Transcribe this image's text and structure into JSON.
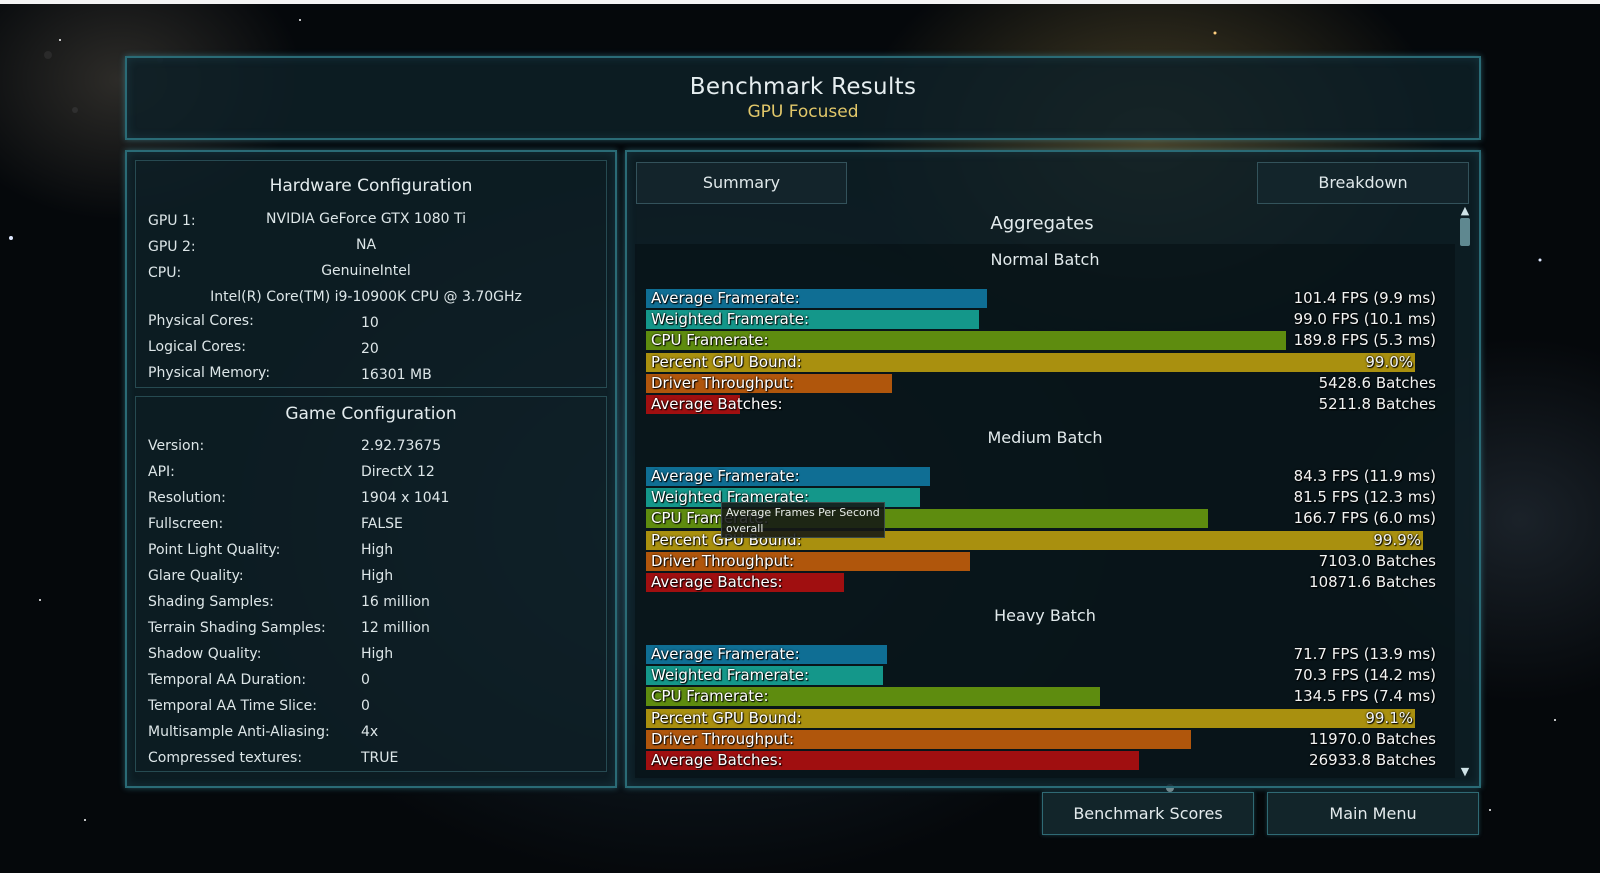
{
  "header": {
    "title": "Benchmark Results",
    "subtitle": "GPU Focused"
  },
  "hardware": {
    "title": "Hardware Configuration",
    "gpu1_label": "GPU 1:",
    "gpu1_value": "NVIDIA GeForce GTX 1080 Ti",
    "gpu2_label": "GPU 2:",
    "gpu2_value": "NA",
    "cpu_label": "CPU:",
    "cpu_vendor": "GenuineIntel",
    "cpu_model": "Intel(R) Core(TM) i9-10900K CPU @ 3.70GHz",
    "rows": [
      {
        "label": "Physical Cores:",
        "value": "10"
      },
      {
        "label": "Logical Cores:",
        "value": "20"
      },
      {
        "label": "Physical Memory:",
        "value": "16301  MB"
      }
    ]
  },
  "game": {
    "title": "Game Configuration",
    "rows": [
      {
        "label": "Version:",
        "value": "2.92.73675"
      },
      {
        "label": "API:",
        "value": "DirectX 12"
      },
      {
        "label": "Resolution:",
        "value": "1904 x 1041"
      },
      {
        "label": "Fullscreen:",
        "value": "FALSE"
      },
      {
        "label": "Point Light Quality:",
        "value": "High"
      },
      {
        "label": "Glare Quality:",
        "value": "High"
      },
      {
        "label": "Shading Samples:",
        "value": "16 million"
      },
      {
        "label": "Terrain Shading Samples:",
        "value": "12 million"
      },
      {
        "label": "Shadow Quality:",
        "value": "High"
      },
      {
        "label": "Temporal AA Duration:",
        "value": "0"
      },
      {
        "label": "Temporal AA Time Slice:",
        "value": "0"
      },
      {
        "label": "Multisample Anti-Aliasing:",
        "value": "4x"
      },
      {
        "label": "Compressed textures:",
        "value": "TRUE"
      }
    ]
  },
  "tabs": {
    "summary": "Summary",
    "breakdown": "Breakdown"
  },
  "aggregates_title": "Aggregates",
  "metric_colors": {
    "avg_framerate": "#0f6e94",
    "weighted_framerate": "#14978a",
    "cpu_framerate": "#5e8c0f",
    "gpu_bound": "#a9900f",
    "driver_throughput": "#b0560c",
    "avg_batches": "#a00f10"
  },
  "batches": [
    {
      "title": "Normal Batch",
      "metrics": [
        {
          "key": "avg_framerate",
          "label": "Average Framerate:",
          "value": "101.4 FPS (9.9 ms)",
          "fill": 0.432
        },
        {
          "key": "weighted_framerate",
          "label": "Weighted Framerate:",
          "value": "99.0 FPS (10.1 ms)",
          "fill": 0.422
        },
        {
          "key": "cpu_framerate",
          "label": "CPU Framerate:",
          "value": "189.8 FPS (5.3 ms)",
          "fill": 0.81
        },
        {
          "key": "gpu_bound",
          "label": "Percent GPU Bound:",
          "value": "99.0%",
          "fill": 0.974
        },
        {
          "key": "driver_throughput",
          "label": "Driver Throughput:",
          "value": "5428.6 Batches",
          "fill": 0.312
        },
        {
          "key": "avg_batches",
          "label": "Average Batches:",
          "value": "5211.8 Batches",
          "fill": 0.119
        }
      ]
    },
    {
      "title": "Medium Batch",
      "metrics": [
        {
          "key": "avg_framerate",
          "label": "Average Framerate:",
          "value": "84.3 FPS (11.9 ms)",
          "fill": 0.359
        },
        {
          "key": "weighted_framerate",
          "label": "Weighted Framerate:",
          "value": "81.5 FPS (12.3 ms)",
          "fill": 0.347
        },
        {
          "key": "cpu_framerate",
          "label": "CPU Framerate:",
          "value": "166.7 FPS (6.0 ms)",
          "fill": 0.711
        },
        {
          "key": "gpu_bound",
          "label": "Percent GPU Bound:",
          "value": "99.9%",
          "fill": 0.983
        },
        {
          "key": "driver_throughput",
          "label": "Driver Throughput:",
          "value": "7103.0 Batches",
          "fill": 0.41
        },
        {
          "key": "avg_batches",
          "label": "Average Batches:",
          "value": "10871.6 Batches",
          "fill": 0.25
        }
      ]
    },
    {
      "title": "Heavy Batch",
      "metrics": [
        {
          "key": "avg_framerate",
          "label": "Average Framerate:",
          "value": "71.7 FPS (13.9 ms)",
          "fill": 0.305
        },
        {
          "key": "weighted_framerate",
          "label": "Weighted Framerate:",
          "value": "70.3 FPS (14.2 ms)",
          "fill": 0.3
        },
        {
          "key": "cpu_framerate",
          "label": "CPU Framerate:",
          "value": "134.5 FPS (7.4 ms)",
          "fill": 0.575
        },
        {
          "key": "gpu_bound",
          "label": "Percent GPU Bound:",
          "value": "99.1%",
          "fill": 0.974
        },
        {
          "key": "driver_throughput",
          "label": "Driver Throughput:",
          "value": "11970.0 Batches",
          "fill": 0.69
        },
        {
          "key": "avg_batches",
          "label": "Average Batches:",
          "value": "26933.8 Batches",
          "fill": 0.624
        }
      ]
    }
  ],
  "tooltip": {
    "line1": "Average Frames Per Second",
    "line2": "overall"
  },
  "scroll": {
    "up_icon": "▲",
    "down_icon": "▼"
  },
  "buttons": {
    "benchmark_scores": "Benchmark Scores",
    "main_menu": "Main Menu"
  }
}
